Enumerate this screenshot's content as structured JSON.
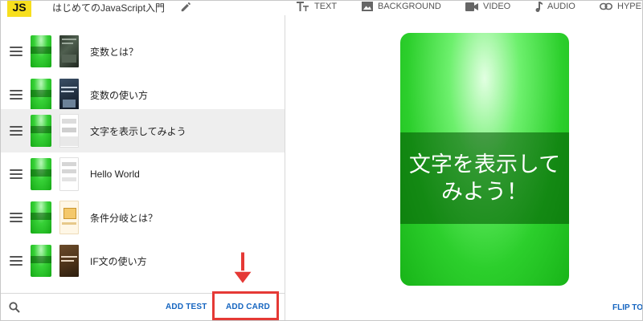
{
  "app": {
    "logo_text": "JS",
    "deck_title": "はじめてのJavaScript入門"
  },
  "toolbar": [
    {
      "label": "TEXT",
      "icon": "text-format-icon"
    },
    {
      "label": "BACKGROUND",
      "icon": "image-icon"
    },
    {
      "label": "VIDEO",
      "icon": "videocam-icon"
    },
    {
      "label": "AUDIO",
      "icon": "music-note-icon"
    },
    {
      "label": "HYPERL",
      "icon": "link-icon"
    }
  ],
  "cards": [
    {
      "label": "変数とは？",
      "selected": false
    },
    {
      "label": "変数の使い方",
      "selected": false
    },
    {
      "label": "文字を表示してみよう",
      "selected": true
    },
    {
      "label": "Hello World",
      "selected": false
    },
    {
      "label": "条件分岐とは？",
      "selected": false
    },
    {
      "label": "IF文の使い方",
      "selected": false
    }
  ],
  "bottom": {
    "add_test": "ADD TEST",
    "add_card": "ADD CARD"
  },
  "preview": {
    "text": "文字を表示して\nみよう！",
    "flip_label": "FLIP TO"
  },
  "colors": {
    "accent": "#1565c0",
    "highlight": "#e53935",
    "card_green": "#2ccf2c",
    "logo_yellow": "#f7df1e"
  }
}
